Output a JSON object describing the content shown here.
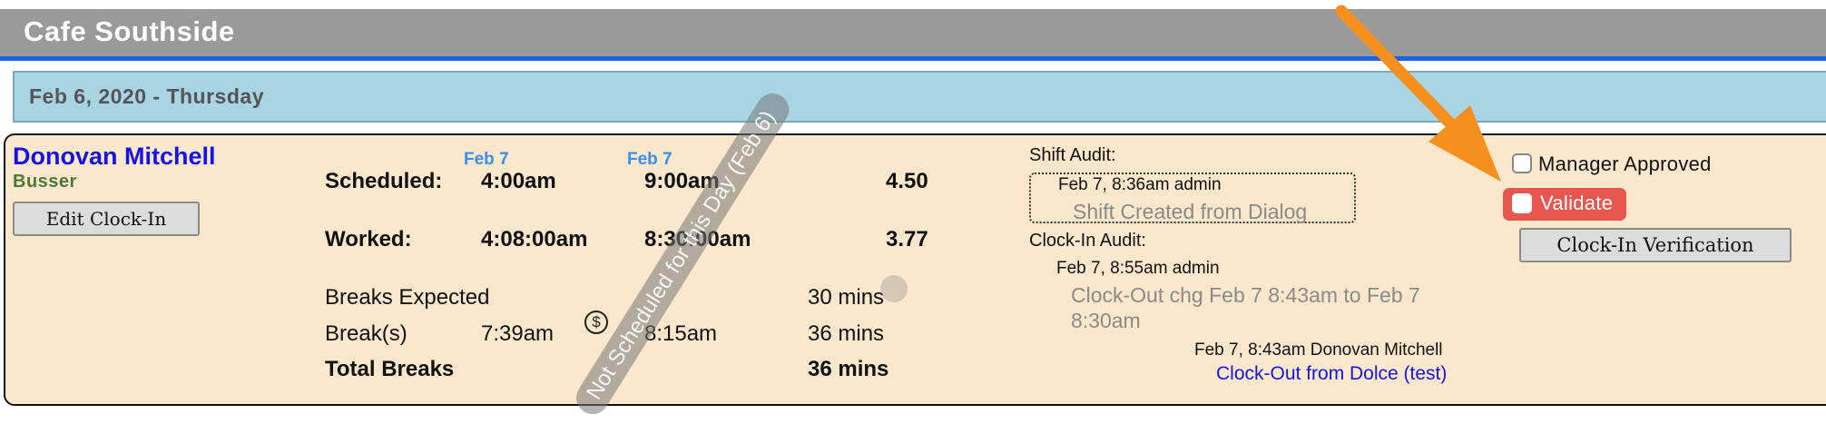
{
  "header": {
    "title": "Cafe Southside"
  },
  "date_bar": {
    "date": "Feb 6, 2020 - Thursday"
  },
  "employee": {
    "name": "Donovan Mitchell",
    "role": "Busser",
    "edit_button": "Edit Clock-In"
  },
  "hours": {
    "start_date_hint": "Feb 7",
    "end_date_hint": "Feb 7",
    "scheduled": {
      "label": "Scheduled:",
      "start": "4:00am",
      "end": "9:00am",
      "total": "4.50"
    },
    "worked": {
      "label": "Worked:",
      "start": "4:08:00am",
      "end": "8:30:00am",
      "total": "3.77"
    },
    "breaks_expected": {
      "label": "Breaks Expected",
      "value": "30 mins"
    },
    "breaks": {
      "label": "Break(s)",
      "start": "7:39am",
      "end": "8:15am",
      "value": "36 mins"
    },
    "total_breaks": {
      "label": "Total Breaks",
      "value": "36 mins"
    }
  },
  "watermark": {
    "text": "Not Scheduled for this Day (Feb 6)"
  },
  "audit": {
    "shift_label": "Shift Audit:",
    "shift_entry": {
      "meta": "Feb 7, 8:36am admin",
      "message": "Shift Created from Dialog"
    },
    "clockin_label": "Clock-In Audit:",
    "clockin_entry": {
      "meta": "Feb 7, 8:55am admin",
      "message_line1": "Clock-Out chg Feb 7 8:43am to Feb 7",
      "message_line2": "8:30am"
    },
    "clockout_entry": {
      "meta": "Feb 7, 8:43am Donovan Mitchell",
      "link": "Clock-Out from Dolce (test)"
    }
  },
  "approvals": {
    "manager_approved": {
      "label": "Manager Approved",
      "checked": false
    },
    "validate": {
      "label": "Validate",
      "checked": false,
      "highlight_color": "#e85650"
    },
    "verify_button": "Clock-In Verification"
  },
  "annotation": {
    "arrow_color": "#f5901e"
  }
}
